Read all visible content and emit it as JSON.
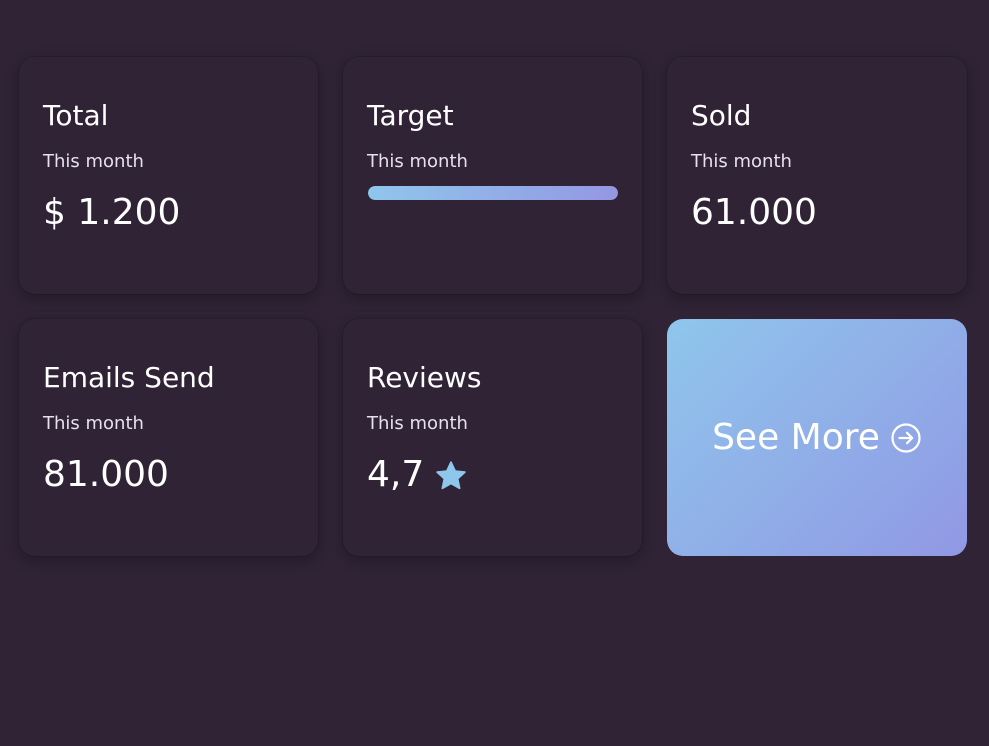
{
  "colors": {
    "background": "#2f2335",
    "accent_start": "#8fc6ec",
    "accent_end": "#9198e4",
    "star": "#8fc6ec"
  },
  "cards": {
    "total": {
      "title": "Total",
      "subtitle": "This month",
      "value": "$ 1.200"
    },
    "target": {
      "title": "Target",
      "subtitle": "This month",
      "progress": 1.0
    },
    "sold": {
      "title": "Sold",
      "subtitle": "This month",
      "value": "61.000"
    },
    "emails": {
      "title": "Emails Send",
      "subtitle": "This month",
      "value": "81.000"
    },
    "reviews": {
      "title": "Reviews",
      "subtitle": "This month",
      "value": "4,7",
      "icon": "star-icon"
    }
  },
  "see_more": {
    "label": "See More",
    "icon": "arrow-circle-right-icon"
  }
}
